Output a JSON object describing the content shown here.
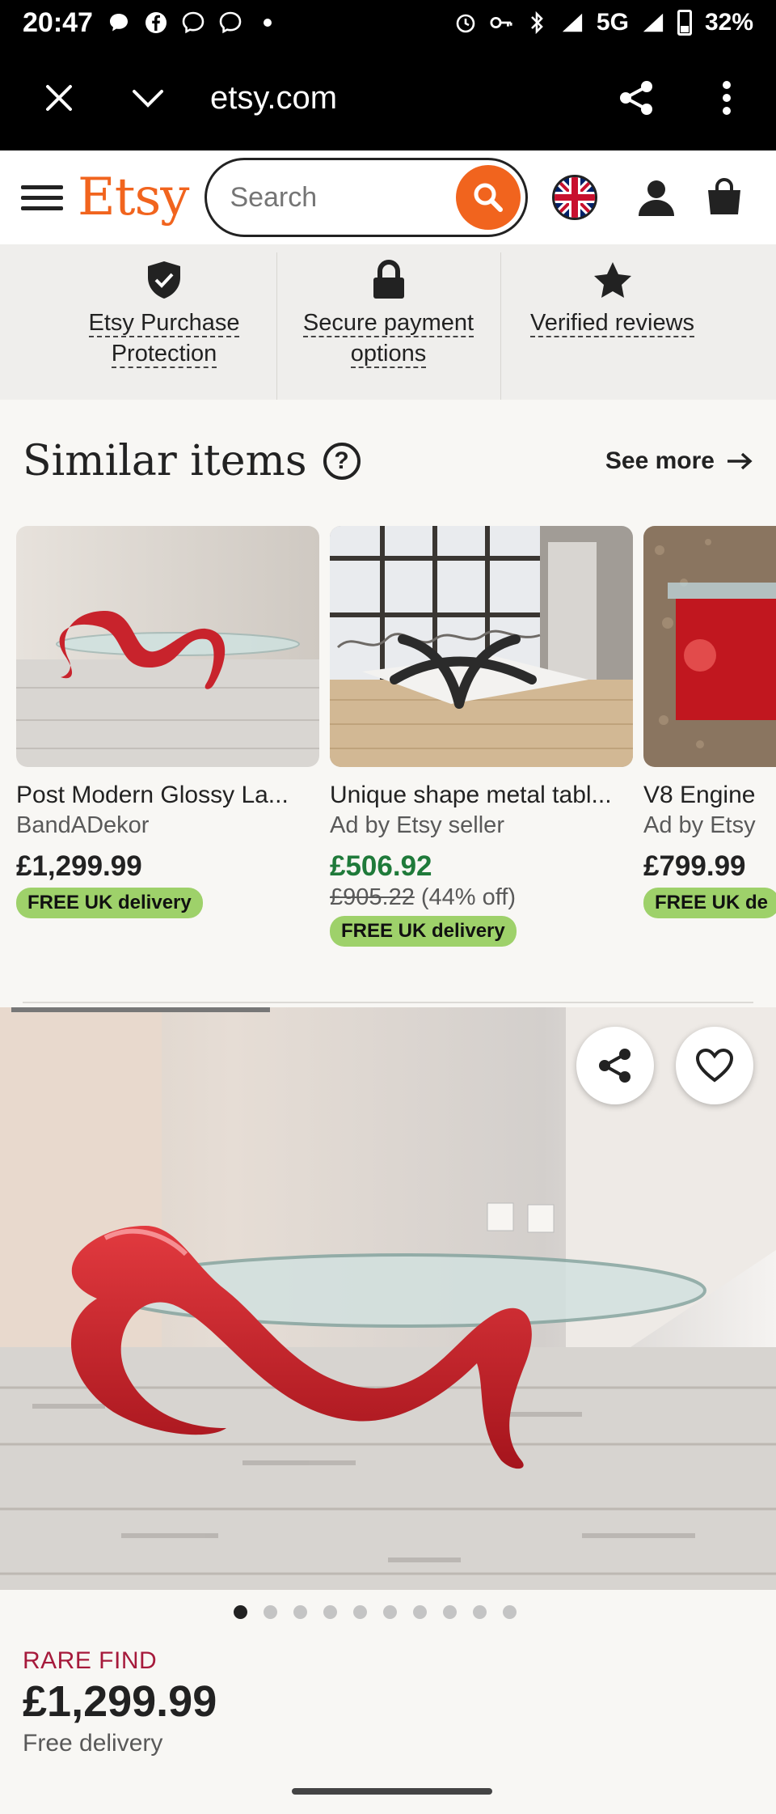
{
  "status_bar": {
    "time": "20:47",
    "network": "5G",
    "battery": "32%"
  },
  "browser": {
    "url": "etsy.com"
  },
  "header": {
    "logo": "Etsy",
    "search_placeholder": "Search"
  },
  "trust": [
    {
      "line1": "Etsy Purchase",
      "line2": "Protection",
      "icon": "shield-check-icon"
    },
    {
      "line1": "Secure payment",
      "line2": "options",
      "icon": "lock-icon"
    },
    {
      "line1": "Verified reviews",
      "line2": "",
      "icon": "star-icon"
    }
  ],
  "similar": {
    "title": "Similar items",
    "see_more": "See more",
    "items": [
      {
        "title": "Post Modern Glossy La...",
        "seller": "BandADekor",
        "price": "£1,299.99",
        "original_price": "",
        "discount": "",
        "delivery": "FREE UK delivery"
      },
      {
        "title": "Unique shape metal tabl...",
        "seller": "Ad by Etsy seller",
        "price": "£506.92",
        "original_price": "£905.22",
        "discount": "(44% off)",
        "delivery": "FREE UK delivery"
      },
      {
        "title": "V8 Engine",
        "seller": "Ad by Etsy",
        "price": "£799.99",
        "original_price": "",
        "discount": "",
        "delivery": "FREE UK de"
      }
    ]
  },
  "product": {
    "badge": "RARE FIND",
    "price": "£1,299.99",
    "delivery": "Free delivery",
    "image_count": 10,
    "active_image": 1
  },
  "colors": {
    "brand": "#f1641e",
    "pill": "#9ed16a",
    "sale": "#1f7a3a",
    "rare": "#a61a3b"
  }
}
